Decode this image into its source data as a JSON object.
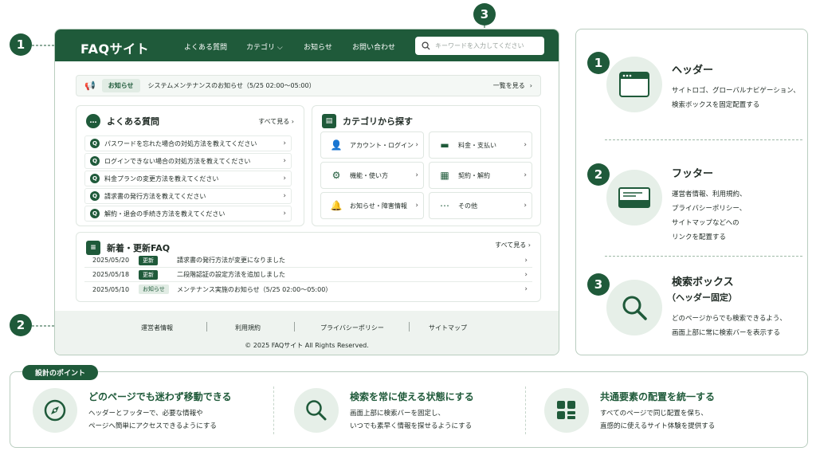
{
  "callouts": [
    "1",
    "2",
    "3"
  ],
  "mock": {
    "brand": "FAQサイト",
    "nav": [
      "よくある質問",
      "カテゴリ ⌵",
      "お知らせ",
      "お問い合わせ"
    ],
    "search_placeholder": "キーワードを入力してください",
    "notice": {
      "badge": "お知らせ",
      "text": "システムメンテナンスのお知らせ（5/25 02:00〜05:00）",
      "link": "一覧を見る"
    },
    "faq": {
      "title": "よくある質問",
      "see_all": "すべて見る",
      "items": [
        "パスワードを忘れた場合の対処方法を教えてください",
        "ログインできない場合の対処方法を教えてください",
        "料金プランの変更方法を教えてください",
        "請求書の発行方法を教えてください",
        "解約・退会の手続き方法を教えてください"
      ]
    },
    "categories": {
      "title": "カテゴリから探す",
      "items": [
        "アカウント・ログイン",
        "料金・支払い",
        "機能・使い方",
        "契約・解約",
        "お知らせ・障害情報",
        "その他"
      ]
    },
    "news": {
      "title": "新着・更新FAQ",
      "see_all": "すべて見る",
      "rows": [
        {
          "date": "2025/05/20",
          "tag": "更新",
          "text": "請求書の発行方法が変更になりました"
        },
        {
          "date": "2025/05/18",
          "tag": "更新",
          "text": "二段階認証の設定方法を追加しました"
        },
        {
          "date": "2025/05/10",
          "tag": "お知らせ",
          "text": "メンテナンス実施のお知らせ（5/25 02:00〜05:00）"
        }
      ]
    },
    "footer": {
      "links": [
        "運営者情報",
        "利用規約",
        "プライバシーポリシー",
        "サイトマップ"
      ],
      "copyright": "© 2025 FAQサイト  All Rights Reserved."
    }
  },
  "legend": [
    {
      "num": "1",
      "title": "ヘッダー",
      "desc": [
        "サイトロゴ、グローバルナビゲーション、",
        "検索ボックスを固定配置する"
      ]
    },
    {
      "num": "2",
      "title": "フッター",
      "desc": [
        "運営者情報、利用規約、",
        "プライバシーポリシー、",
        "サイトマップなどへの",
        "リンクを配置する"
      ]
    },
    {
      "num": "3",
      "title": "検索ボックス",
      "subtitle": "（ヘッダー固定）",
      "desc": [
        "どのページからでも検索できるよう、",
        "画面上部に常に検索バーを表示する"
      ]
    }
  ],
  "points": {
    "label": "設計のポイント",
    "items": [
      {
        "title": "どのページでも迷わず移動できる",
        "desc": [
          "ヘッダーとフッターで、必要な情報や",
          "ページへ簡単にアクセスできるようにする"
        ]
      },
      {
        "title": "検索を常に使える状態にする",
        "desc": [
          "画面上部に検索バーを固定し、",
          "いつでも素早く情報を探せるようにする"
        ]
      },
      {
        "title": "共通要素の配置を統一する",
        "desc": [
          "すべてのページで同じ配置を保ち、",
          "直感的に使えるサイト体験を提供する"
        ]
      }
    ]
  },
  "colors": {
    "primary": "#1f5a3a",
    "soft": "#e6efe8"
  }
}
